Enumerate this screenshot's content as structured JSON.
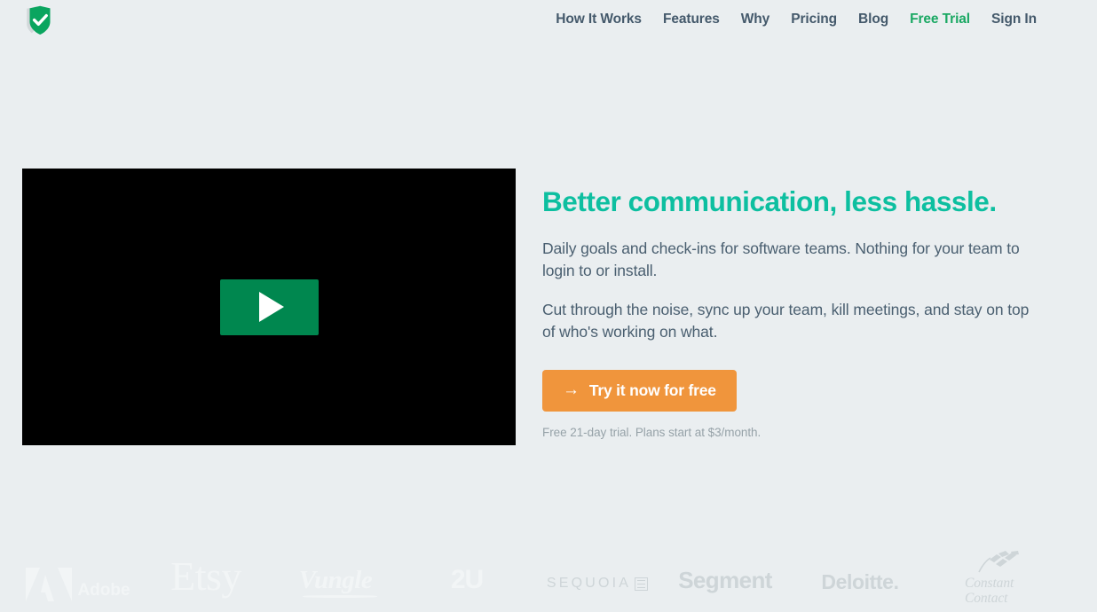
{
  "header": {
    "logo": {
      "name": "shield-check-logo",
      "shield_color": "#0aa55f",
      "back_shield_color": "#d2d8da",
      "check_color": "#ffffff"
    },
    "nav": [
      {
        "label": "How It Works",
        "accent": false
      },
      {
        "label": "Features",
        "accent": false
      },
      {
        "label": "Why",
        "accent": false
      },
      {
        "label": "Pricing",
        "accent": false
      },
      {
        "label": "Blog",
        "accent": false
      },
      {
        "label": "Free Trial",
        "accent": true
      },
      {
        "label": "Sign In",
        "accent": false
      }
    ],
    "nav_color": "#44596b",
    "nav_accent_color": "#1aa863"
  },
  "hero": {
    "video": {
      "poster_color": "#000000",
      "play_button_color": "#00874f",
      "play_icon": "play-triangle-icon"
    },
    "headline": "Better communication, less hassle.",
    "headline_color": "#0dbfa0",
    "paragraph_1": "Daily goals and check-ins for software teams. Nothing for your team to login to or install.",
    "paragraph_2": "Cut through the noise, sync up your team, kill meetings, and stay on top of who's working on what.",
    "paragraph_color": "#4a5f70",
    "cta": {
      "label": "Try it now for free",
      "arrow": "→",
      "background": "#f0953c",
      "text_color": "#ffffff"
    },
    "fineprint": "Free 21-day trial. Plans start at $3/month.",
    "fineprint_color": "#96a2a8"
  },
  "logo_strip": {
    "logos": [
      {
        "name": "adobe",
        "label": "Adobe",
        "tone": "white"
      },
      {
        "name": "etsy",
        "label": "Etsy",
        "tone": "white"
      },
      {
        "name": "vungle",
        "label": "Vungle",
        "tone": "white"
      },
      {
        "name": "2u",
        "label": "2U",
        "tone": "white"
      },
      {
        "name": "sequoia",
        "label": "SEQUOIA",
        "tone": "gray"
      },
      {
        "name": "segment",
        "label": "Segment",
        "tone": "gray"
      },
      {
        "name": "deloitte",
        "label": "Deloitte.",
        "tone": "gray"
      },
      {
        "name": "constant-contact",
        "label_line1": "Constant",
        "label_line2": "Contact",
        "tone": "gray"
      }
    ]
  },
  "page": {
    "background": "#eaeef0"
  }
}
